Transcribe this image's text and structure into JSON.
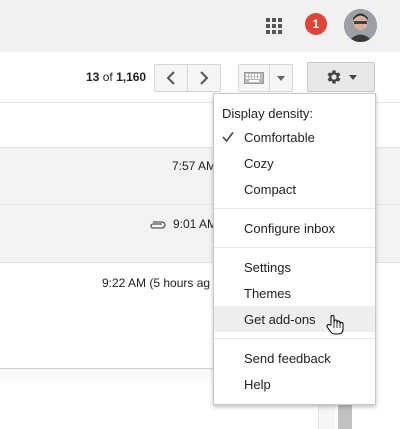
{
  "header": {
    "apps_icon": "apps-grid-icon",
    "notification_count": "1",
    "notification_color": "#db4437",
    "avatar": "user-avatar"
  },
  "toolbar": {
    "pager_start": "13",
    "pager_of": "of",
    "pager_total": "1,160",
    "prev_icon": "chevron-left-icon",
    "next_icon": "chevron-right-icon",
    "keyboard_icon": "keyboard-icon",
    "settings_icon": "gear-icon"
  },
  "mail_list": {
    "rows": [
      {
        "time": "7:57 AM",
        "attachment": false
      },
      {
        "time": "9:01 AM",
        "attachment": true
      },
      {
        "time": "9:22 AM (5 hours ag",
        "attachment": false
      }
    ]
  },
  "settings_menu": {
    "density_header": "Display density:",
    "density_options": [
      {
        "label": "Comfortable",
        "selected": true
      },
      {
        "label": "Cozy",
        "selected": false
      },
      {
        "label": "Compact",
        "selected": false
      }
    ],
    "configure_inbox": "Configure inbox",
    "items": [
      {
        "label": "Settings"
      },
      {
        "label": "Themes"
      },
      {
        "label": "Get add-ons",
        "highlighted": true
      }
    ],
    "send_feedback": "Send feedback",
    "help": "Help"
  }
}
